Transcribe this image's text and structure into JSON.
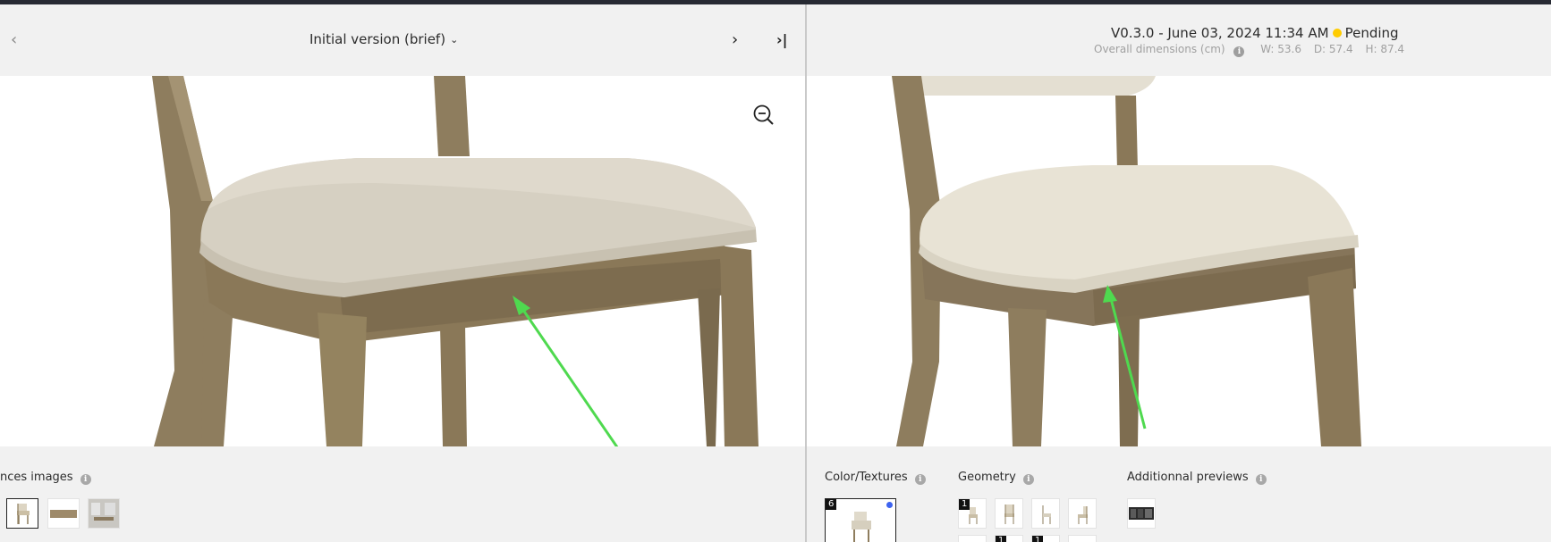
{
  "left_header": {
    "version_label": "Initial version (brief)",
    "prev_icon": "chevron-left-icon",
    "next_icon": "chevron-right-icon",
    "last_icon": "skip-to-end-icon"
  },
  "right_header": {
    "version_text": "V0.3.0 - June 03, 2024 11:34 AM",
    "status": "Pending",
    "status_color": "#ffcc00",
    "dims_label": "Overall dimensions (cm)",
    "width": "W: 53.6",
    "depth": "D: 57.4",
    "height": "H: 87.4"
  },
  "left_bottom": {
    "references_label": "nces images"
  },
  "right_bottom": {
    "color_label": "Color/Textures",
    "color_badge": "6",
    "geometry_label": "Geometry",
    "geometry_badges": [
      "1",
      "1",
      "1"
    ],
    "previews_label": "Additionnal previews"
  },
  "colors": {
    "annotation_arrow": "#4fd94f",
    "selected_dot": "#3d63f0",
    "wood": "#8c7a5b",
    "fabric_left": "#d7d1c3",
    "fabric_right": "#e9e4d6"
  }
}
